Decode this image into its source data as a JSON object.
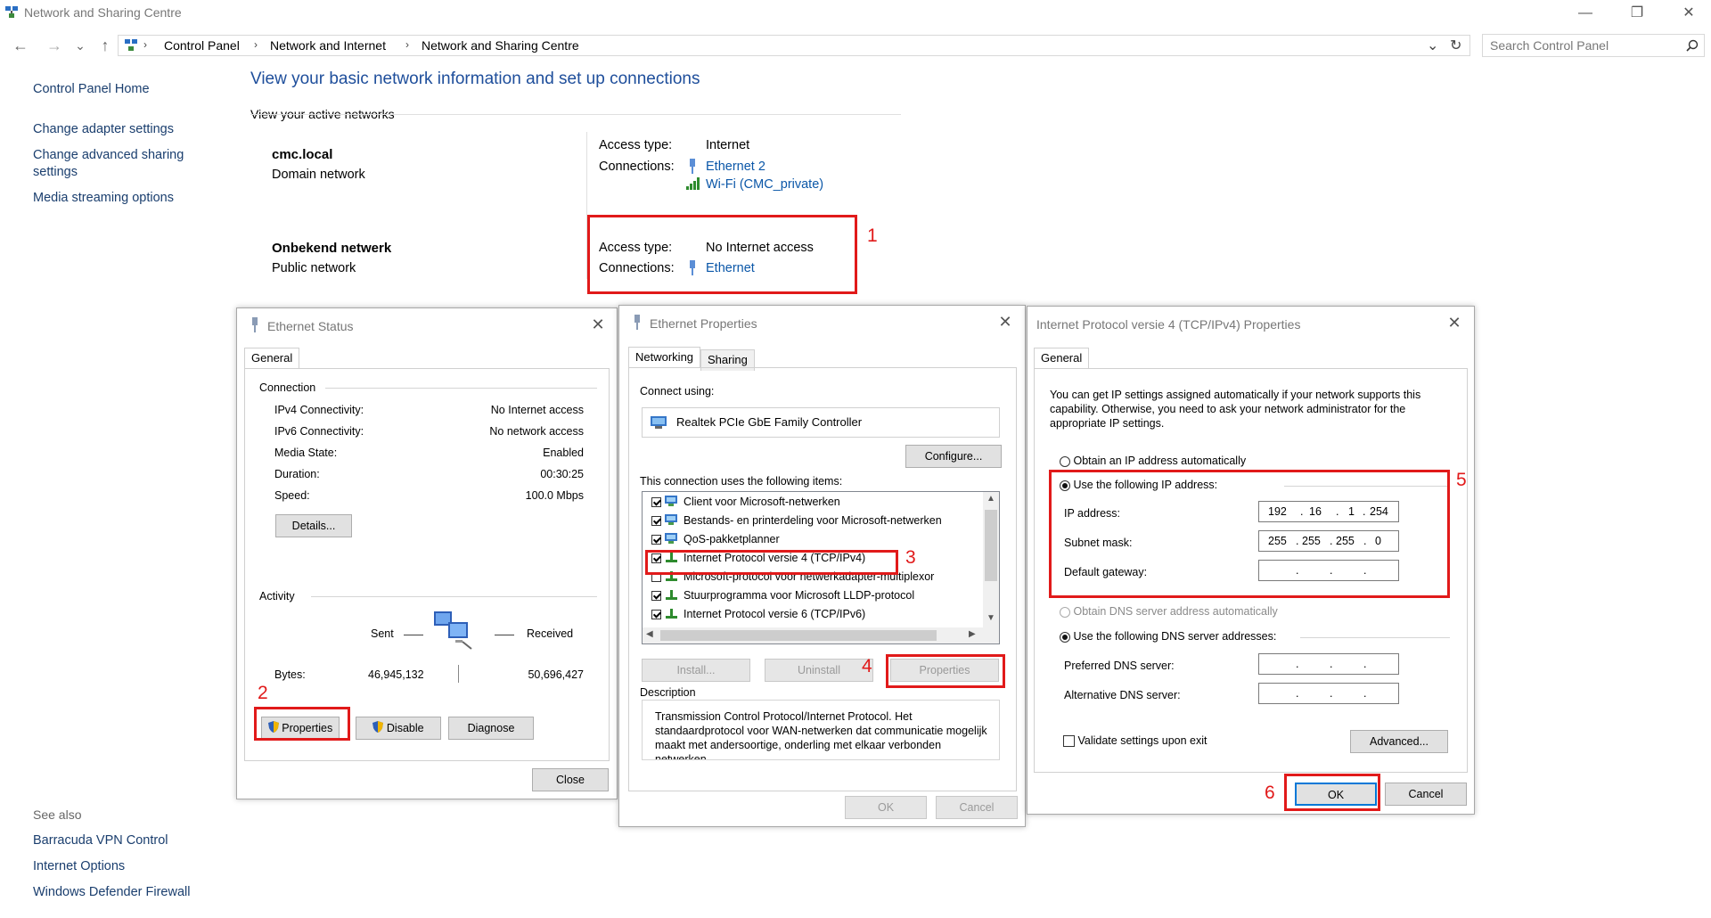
{
  "window": {
    "title": "Network and Sharing Centre",
    "controls": {
      "minimize": "—",
      "maximize": "❐",
      "close": "✕"
    }
  },
  "nav": {
    "back": "←",
    "forward": "→",
    "recent": "⌄",
    "up": "↑",
    "breadcrumb": [
      "Control Panel",
      "Network and Internet",
      "Network and Sharing Centre"
    ],
    "dropdown": "⌄",
    "refresh": "↻",
    "search_placeholder": "Search Control Panel"
  },
  "sidebar": {
    "home": "Control Panel Home",
    "links": [
      "Change adapter settings",
      "Change advanced sharing",
      "settings",
      "Media streaming options"
    ],
    "see_also_label": "See also",
    "see_also": [
      "Barracuda VPN Control",
      "Internet Options",
      "Windows Defender Firewall"
    ]
  },
  "main": {
    "heading": "View your basic network information and set up connections",
    "active_networks": "View your active networks",
    "networks": [
      {
        "name": "cmc.local",
        "type": "Domain network",
        "access_label": "Access type:",
        "access": "Internet",
        "connections_label": "Connections:",
        "connections": [
          "Ethernet 2",
          "Wi-Fi (CMC_private)"
        ]
      },
      {
        "name": "Onbekend netwerk",
        "type": "Public network",
        "access_label": "Access type:",
        "access": "No Internet access",
        "connections_label": "Connections:",
        "connections": [
          "Ethernet"
        ]
      }
    ]
  },
  "annotations": [
    "1",
    "2",
    "3",
    "4",
    "5",
    "6"
  ],
  "status_dialog": {
    "title": "Ethernet Status",
    "tab": "General",
    "connection_label": "Connection",
    "rows": [
      {
        "label": "IPv4 Connectivity:",
        "value": "No Internet access"
      },
      {
        "label": "IPv6 Connectivity:",
        "value": "No network access"
      },
      {
        "label": "Media State:",
        "value": "Enabled"
      },
      {
        "label": "Duration:",
        "value": "00:30:25"
      },
      {
        "label": "Speed:",
        "value": "100.0 Mbps"
      }
    ],
    "details_button": "Details...",
    "activity_label": "Activity",
    "sent_label": "Sent",
    "received_label": "Received",
    "bytes_label": "Bytes:",
    "bytes_sent": "46,945,132",
    "bytes_received": "50,696,427",
    "properties_button": "Properties",
    "disable_button": "Disable",
    "diagnose_button": "Diagnose",
    "close_button": "Close"
  },
  "properties_dialog": {
    "title": "Ethernet Properties",
    "tabs": [
      "Networking",
      "Sharing"
    ],
    "connect_using_label": "Connect using:",
    "adapter": "Realtek PCIe GbE Family Controller",
    "configure_button": "Configure...",
    "items_label": "This connection uses the following items:",
    "items": [
      {
        "label": "Client voor Microsoft-netwerken",
        "checked": true
      },
      {
        "label": "Bestands- en printerdeling voor Microsoft-netwerken",
        "checked": true
      },
      {
        "label": "QoS-pakketplanner",
        "checked": true
      },
      {
        "label": "Internet Protocol versie 4 (TCP/IPv4)",
        "checked": true
      },
      {
        "label": "Microsoft-protocol voor netwerkadapter-multiplexor",
        "checked": false
      },
      {
        "label": "Stuurprogramma voor Microsoft LLDP-protocol",
        "checked": true
      },
      {
        "label": "Internet Protocol versie 6 (TCP/IPv6)",
        "checked": true
      }
    ],
    "install_button": "Install...",
    "uninstall_button": "Uninstall",
    "properties_button": "Properties",
    "description_label": "Description",
    "description": "Transmission Control Protocol/Internet Protocol. Het standaardprotocol voor WAN-netwerken dat communicatie mogelijk maakt met andersoortige, onderling met elkaar verbonden netwerken.",
    "ok_button": "OK",
    "cancel_button": "Cancel"
  },
  "ipv4_dialog": {
    "title": "Internet Protocol versie 4 (TCP/IPv4) Properties",
    "tab": "General",
    "intro": "You can get IP settings assigned automatically if your network supports this capability. Otherwise, you need to ask your network administrator for the appropriate IP settings.",
    "obtain_auto": "Obtain an IP address automatically",
    "use_following": "Use the following IP address:",
    "ip_label": "IP address:",
    "ip": [
      "192",
      "16",
      "1",
      "254"
    ],
    "mask_label": "Subnet mask:",
    "mask": [
      "255",
      "255",
      "255",
      "0"
    ],
    "gateway_label": "Default gateway:",
    "dns_auto": "Obtain DNS server address automatically",
    "dns_use": "Use the following DNS server addresses:",
    "preferred_dns": "Preferred DNS server:",
    "alternative_dns": "Alternative DNS server:",
    "validate": "Validate settings upon exit",
    "advanced_button": "Advanced...",
    "ok_button": "OK",
    "cancel_button": "Cancel"
  }
}
